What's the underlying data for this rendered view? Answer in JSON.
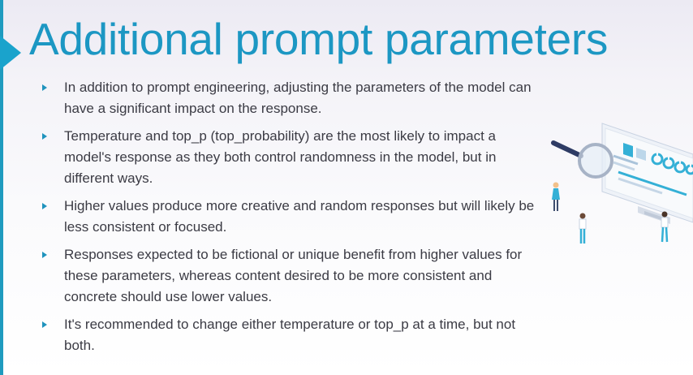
{
  "title": "Additional prompt parameters",
  "bullets": [
    {
      "text": "In addition to prompt engineering, adjusting the parameters of the model can have a significant impact on the response."
    },
    {
      "text": "Temperature and top_p (top_probability) are the most likely to impact a model's response as they both control randomness in the model, but in different ways."
    },
    {
      "text": "Higher values produce more creative and random responses but will likely be less consistent or focused."
    },
    {
      "text": "Responses expected to be fictional or unique benefit from higher values for these parameters, whereas content desired to be more consistent and concrete should use lower values."
    },
    {
      "text": "It's recommended to change either temperature or top_p at a time, but not both."
    }
  ],
  "colors": {
    "accent": "#1c97c3",
    "body_text": "#3b3b44",
    "illustration_blue": "#34b0d6"
  },
  "icons": {
    "bullet": "triangle-bullet-icon",
    "title_marker": "triangle-arrow-icon",
    "illustration": "magnifier-dashboard-illustration"
  }
}
